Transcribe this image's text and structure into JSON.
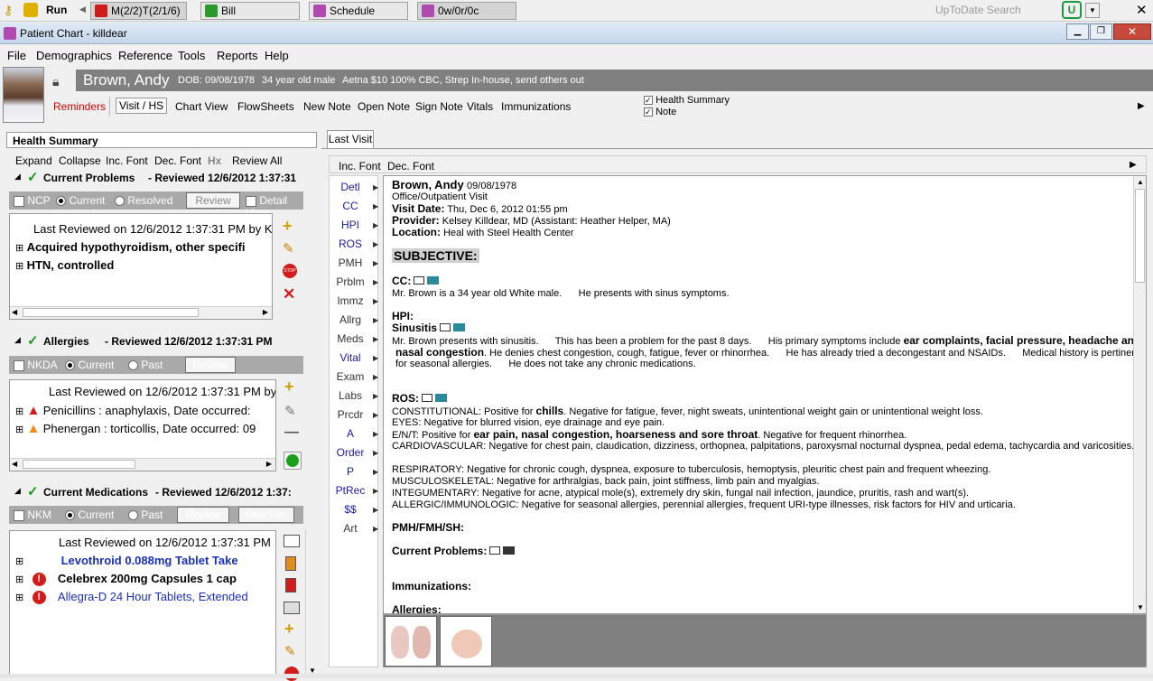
{
  "taskbar": {
    "run": "Run",
    "tabs": [
      "M(2/2)T(2/1/6)",
      "Bill",
      "Schedule",
      "0w/0r/0c"
    ],
    "search": "UpToDate Search"
  },
  "window": {
    "title": "Patient Chart - killdear"
  },
  "menu": [
    "File",
    "Demographics",
    "Reference",
    "Tools",
    "Reports",
    "Help"
  ],
  "patient": {
    "name": "Brown, Andy",
    "dob": "DOB: 09/08/1978",
    "age": "34 year old male",
    "insurance": "Aetna  $10  100%  CBC, Strep In-house, send others out"
  },
  "toolbar": {
    "reminders": "Reminders",
    "visit": "Visit / HS",
    "chart": "Chart View",
    "flow": "FlowSheets",
    "newnote": "New Note",
    "opennote": "Open Note",
    "signnote": "Sign Note",
    "vitals": "Vitals",
    "immun": "Immunizations",
    "hs_check": "Health Summary",
    "note_check": "Note"
  },
  "left": {
    "title": "Health Summary",
    "tools": [
      "Expand",
      "Collapse",
      "Inc. Font",
      "Dec. Font",
      "Hx",
      "Review All"
    ],
    "problems": {
      "head": "Current Problems",
      "reviewed": "- Reviewed 12/6/2012 1:37:31",
      "ncp": "NCP",
      "current": "Current",
      "resolved": "Resolved",
      "review": "Review",
      "detail": "Detail View",
      "last": "Last Reviewed on 12/6/2012 1:37:31 PM by K",
      "items": [
        "Acquired hypothyroidism, other specifi",
        "HTN, controlled"
      ]
    },
    "allergies": {
      "head": "Allergies",
      "reviewed": "- Reviewed 12/6/2012 1:37:31 PM",
      "nkda": "NKDA",
      "current": "Current",
      "past": "Past",
      "review": "Review",
      "last": "Last Reviewed on 12/6/2012 1:37:31 PM by",
      "items": [
        "Penicillins : anaphylaxis, Date occurred:",
        "Phenergan : torticollis, Date occurred: 09"
      ]
    },
    "meds": {
      "head": "Current Medications",
      "reviewed": "- Reviewed 12/6/2012 1:37:",
      "nkm": "NKM",
      "current": "Current",
      "past": "Past",
      "review": "Review",
      "medrec": "Med Rec",
      "last": "Last Reviewed on 12/6/2012 1:37:31 PM",
      "items": [
        "Levothroid 0.088mg Tablet Take",
        "Celebrex 200mg Capsules 1 cap",
        "Allegra-D 24 Hour Tablets, Extended"
      ]
    }
  },
  "right": {
    "tab": "Last Visit",
    "incfont": "Inc. Font",
    "decfont": "Dec. Font",
    "nav": [
      "Detl",
      "CC",
      "HPI",
      "ROS",
      "PMH",
      "Prblm",
      "Immz",
      "Allrg",
      "Meds",
      "Vital",
      "Exam",
      "Labs",
      "Prcdr",
      "A",
      "Order",
      "P",
      "PtRec",
      "$$",
      "Art"
    ],
    "note": {
      "name": "Brown, Andy",
      "dob": "09/08/1978",
      "type": "Office/Outpatient Visit",
      "visitdate_l": "Visit Date:",
      "visitdate": "Thu, Dec 6, 2012 01:55 pm",
      "provider_l": "Provider:",
      "provider": "Kelsey Killdear, MD (Assistant: Heather Helper, MA)",
      "location_l": "Location:",
      "location": "Heal with Steel Health Center",
      "subjective": "SUBJECTIVE:",
      "cc": "CC:",
      "cc_text1": "Mr. Brown is a 34 year old White male.",
      "cc_text2": "He presents with sinus symptoms.",
      "hpi": "HPI:",
      "sinusitis": "Sinusitis",
      "hpi1a": "Mr. Brown presents with sinusitis.",
      "hpi1b": "This has been a problem for the past 8 days.",
      "hpi1c": "His primary symptoms include",
      "hpi1d": "ear complaints, facial pressure, headache and",
      "hpi2a": "nasal congestion",
      "hpi2b": ". He denies chest congestion, cough, fatigue, fever or rhinorrhea.",
      "hpi2c": "He has already tried a decongestant and NSAIDs.",
      "hpi2d": "Medical history is pertinent",
      "hpi3a": "for seasonal allergies.",
      "hpi3b": "He does not take any chronic medications.",
      "ros": "ROS:",
      "ros1a": "CONSTITUTIONAL:  Positive for",
      "ros1b": "chills",
      "ros1c": ".   Negative for fatigue, fever, night sweats, unintentional weight gain or unintentional weight loss.",
      "ros2": "EYES:  Negative for blurred vision, eye drainage and eye pain.",
      "ros3a": "E/N/T:  Positive for",
      "ros3b": "ear pain, nasal congestion, hoarseness and sore throat",
      "ros3c": ".   Negative for frequent rhinorrhea.",
      "ros4": "CARDIOVASCULAR:  Negative for chest pain, claudication, dizziness, orthopnea, palpitations, paroxysmal nocturnal dyspnea, pedal edema, tachycardia and varicosities.",
      "ros5": "RESPIRATORY:  Negative for chronic cough, dyspnea, exposure to tuberculosis, hemoptysis, pleuritic chest pain and frequent wheezing.",
      "ros6": "MUSCULOSKELETAL:  Negative for arthralgias, back pain, joint stiffness, limb pain and myalgias.",
      "ros7": "INTEGUMENTARY:  Negative for acne, atypical mole(s), extremely dry skin, fungal nail infection, jaundice, pruritis, rash and wart(s).",
      "ros8": "ALLERGIC/IMMUNOLOGIC:  Negative for seasonal allergies, perennial allergies, frequent URI-type illnesses, risk factors for HIV and urticaria.",
      "pmh": "PMH/FMH/SH:",
      "cp": "Current Problems:",
      "imm": "Immunizations:",
      "all": "Allergies:"
    }
  },
  "colors": {
    "accent_red": "#cc0000",
    "link_blue": "#1a1aa6",
    "patient_bar": "#808080"
  }
}
